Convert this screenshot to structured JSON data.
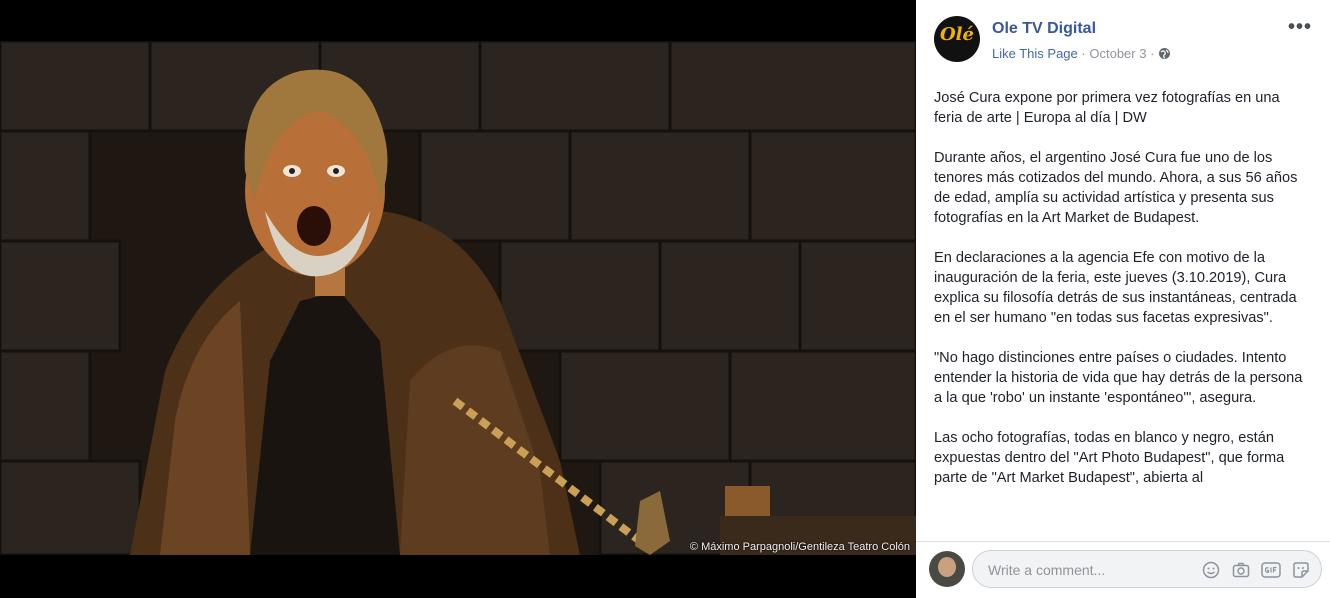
{
  "post": {
    "page_name": "Ole TV Digital",
    "avatar_text": "Olé",
    "like_label": "Like This Page",
    "date": "October 3",
    "separator": "·",
    "paragraphs": [
      "José Cura expone por primera vez fotografías en una feria de arte | Europa al día | DW",
      "Durante años, el argentino José Cura fue uno de los tenores más cotizados del mundo. Ahora, a sus 56 años de edad, amplía su actividad artística y presenta sus fotografías en la Art Market de Budapest.",
      "En declaraciones a la agencia Efe con motivo de la inauguración de la feria, este jueves (3.10.2019), Cura explica su filosofía detrás de sus instantáneas, centrada en el ser humano \"en todas sus facetas expresivas\".",
      "\"No hago distinciones entre países o ciudades. Intento entender la historia de vida que hay detrás de la persona a la que 'robo' un instante 'espontáneo'\", asegura.",
      "Las ocho fotografías, todas en blanco y negro, están expuestas dentro del \"Art Photo Budapest\", que forma parte de \"Art Market Budapest\", abierta al"
    ]
  },
  "photo": {
    "credit": "© Máximo Parpagnoli/Gentileza Teatro Colón"
  },
  "comment": {
    "placeholder": "Write a comment..."
  },
  "icons": {
    "more": "more-options-icon",
    "globe": "globe-icon",
    "emoji": "emoji-icon",
    "camera": "camera-icon",
    "gif": "gif-icon",
    "sticker": "sticker-icon"
  },
  "colors": {
    "link": "#385898",
    "meta": "#90949c",
    "text": "#1d2129"
  }
}
